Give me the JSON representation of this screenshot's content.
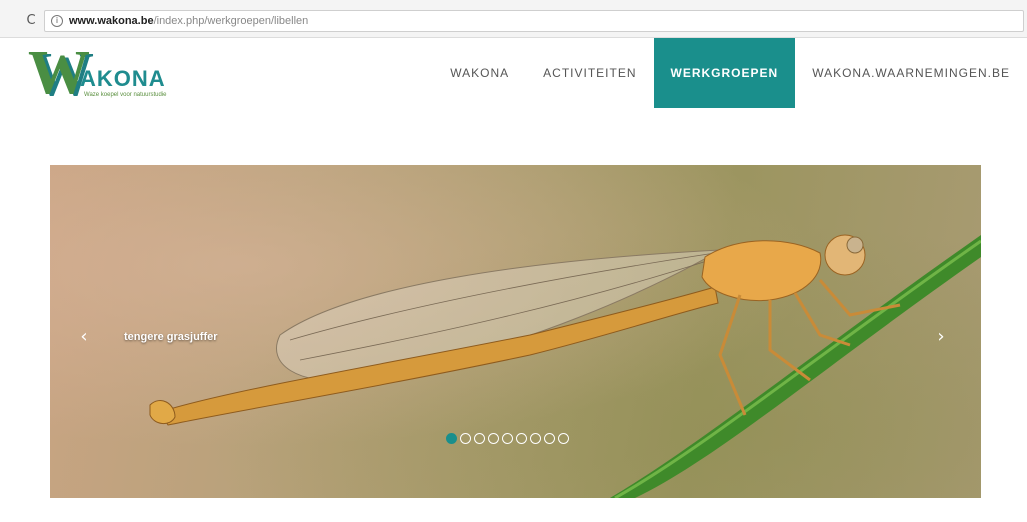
{
  "browser": {
    "url_domain": "www.wakona.be",
    "url_path": "/index.php/werkgroepen/libellen",
    "reload_glyph": "C",
    "info_glyph": "i"
  },
  "logo": {
    "letter": "W",
    "name": "AKONA",
    "tagline": "Waze koepel voor natuurstudie"
  },
  "nav": {
    "items": [
      {
        "label": "WAKONA",
        "active": false
      },
      {
        "label": "ACTIVITEITEN",
        "active": false
      },
      {
        "label": "WERKGROEPEN",
        "active": true
      },
      {
        "label": "WAKONA.WAARNEMINGEN.BE",
        "active": false
      }
    ]
  },
  "slider": {
    "caption": "tengere grasjuffer",
    "prev_glyph": "‹",
    "next_glyph": "›",
    "slide_count": 9,
    "active_slide": 1
  },
  "colors": {
    "accent": "#1a8f8c",
    "logo_green": "#4a8e43"
  }
}
